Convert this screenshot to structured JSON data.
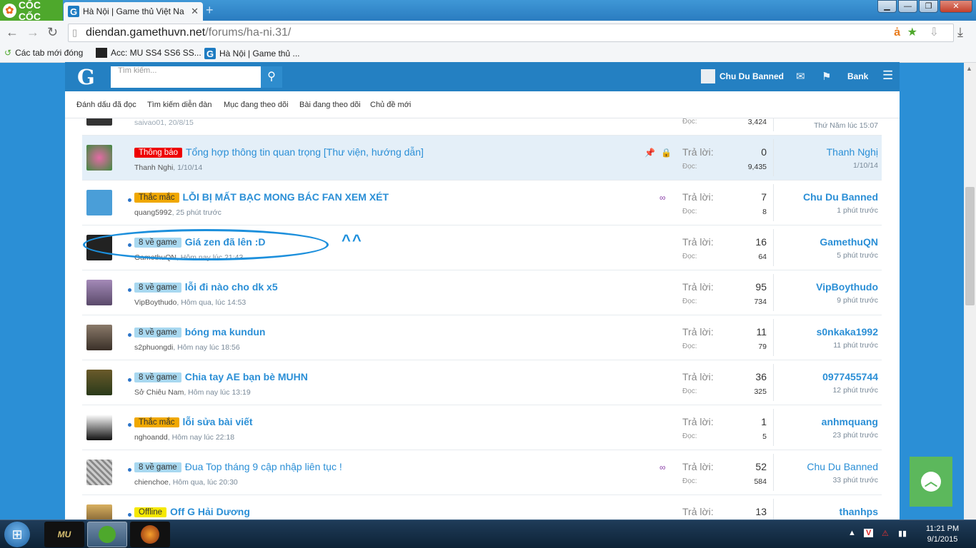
{
  "browser": {
    "brand": "CỐC CỐC",
    "tab_title": "Hà Nội | Game thủ Việt Na",
    "url_domain": "diendan.gamethuvn.net",
    "url_path": "/forums/ha-ni.31/",
    "bookmarks": [
      "Các tab mới đóng",
      "Acc: MU SS4 SS6 SS...",
      "Hà Nội | Game thủ ..."
    ]
  },
  "forum": {
    "logo": "G",
    "search_placeholder": "Tìm kiếm...",
    "username": "Chu Du Banned",
    "bank": "Bank",
    "subnav": [
      "Đánh dấu đã đọc",
      "Tìm kiếm diễn đàn",
      "Mục đang theo dõi",
      "Bài đang theo dõi",
      "Chủ đề mới"
    ],
    "reply_label": "Trả lời:",
    "view_label": "Đọc:",
    "partial_row": {
      "meta": "saivao01, 20/8/15",
      "views": "3,424",
      "last_time": "Thứ Năm lúc 15:07"
    },
    "threads": [
      {
        "prefix": "Thông báo",
        "title": "Tổng hợp thông tin quan trọng [Thư viện, hướng dẫn]",
        "author": "Thanh Nghi",
        "date": "1/10/14",
        "replies": "0",
        "views": "9,435",
        "last_user": "Thanh Nghị",
        "last_time": "1/10/14"
      },
      {
        "prefix": "Thắc mắc",
        "title": "LỖI BỊ MẤT BẠC MONG BÁC FAN XEM XÉT",
        "author": "quang5992",
        "date": "25 phút trước",
        "replies": "7",
        "views": "8",
        "last_user": "Chu Du Banned",
        "last_time": "1 phút trước"
      },
      {
        "prefix": "8 về game",
        "title": "Giá zen đã lên :D",
        "author": "GamethuQN",
        "date": "Hôm nay lúc 21:43",
        "replies": "16",
        "views": "64",
        "last_user": "GamethuQN",
        "last_time": "5 phút trước"
      },
      {
        "prefix": "8 về game",
        "title": "lỗi đi nào cho dk x5",
        "author": "VipBoythudo",
        "date": "Hôm qua, lúc 14:53",
        "replies": "95",
        "views": "734",
        "last_user": "VipBoythudo",
        "last_time": "9 phút trước"
      },
      {
        "prefix": "8 về game",
        "title": "bóng ma kundun",
        "author": "s2phuongdi",
        "date": "Hôm nay lúc 18:56",
        "replies": "11",
        "views": "79",
        "last_user": "s0nkaka1992",
        "last_time": "11 phút trước"
      },
      {
        "prefix": "8 về game",
        "title": "Chia tay AE bạn bè MUHN",
        "author": "Sở Chiêu Nam",
        "date": "Hôm nay lúc 13:19",
        "replies": "36",
        "views": "325",
        "last_user": "0977455744",
        "last_time": "12 phút trước"
      },
      {
        "prefix": "Thắc mắc",
        "title": "lỗi sửa bài viết",
        "author": "nghoandd",
        "date": "Hôm nay lúc 22:18",
        "replies": "1",
        "views": "5",
        "last_user": "anhmquang",
        "last_time": "23 phút trước"
      },
      {
        "prefix": "8 về game",
        "title": "Đua Top tháng 9 cập nhập liên tục !",
        "author": "chienchoe",
        "date": "Hôm qua, lúc 20:30",
        "replies": "52",
        "views": "584",
        "last_user": "Chu Du Banned",
        "last_time": "33 phút trước"
      },
      {
        "prefix": "Offline",
        "title": "Off G Hải Dương",
        "author": "",
        "date": "",
        "replies": "13",
        "views": "",
        "last_user": "thanhps",
        "last_time": ""
      }
    ],
    "annotation_text": "^^"
  },
  "taskbar": {
    "time": "11:21 PM",
    "date": "9/1/2015"
  },
  "colors": {
    "link": "#2b8fd6",
    "header": "#2480c2",
    "sticky_bg": "#e4eff8",
    "annotation": "#1c8fdc",
    "totop": "#5cb85c"
  }
}
